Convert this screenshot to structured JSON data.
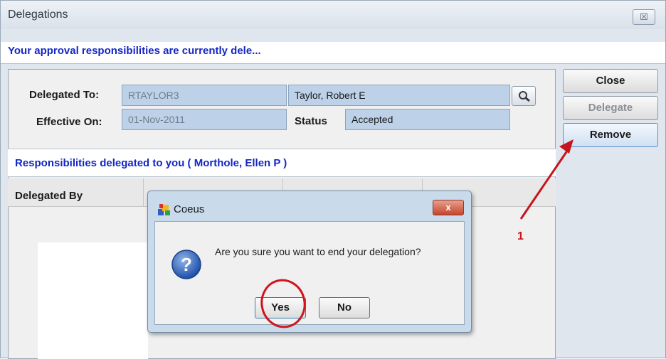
{
  "window": {
    "title": "Delegations",
    "close_glyph": "☒"
  },
  "message": "Your approval responsibilities are currently dele...",
  "form": {
    "delegated_to_label": "Delegated To:",
    "delegated_to_id": "RTAYLOR3",
    "delegated_to_name": "Taylor, Robert E",
    "effective_on_label": "Effective On:",
    "effective_on_value": "01-Nov-2011",
    "status_label": "Status",
    "status_value": "Accepted"
  },
  "side_buttons": {
    "close": "Close",
    "delegate": "Delegate",
    "remove": "Remove"
  },
  "responsibilities_title": "Responsibilities delegated to you ( Morthole, Ellen P )",
  "table": {
    "columns": [
      "Delegated By",
      "",
      "",
      ""
    ]
  },
  "dialog": {
    "title": "Coeus",
    "close_glyph": "x",
    "question": "Are you sure you want to end your delegation?",
    "yes": "Yes",
    "no": "No"
  },
  "annotation": {
    "step": "1",
    "color": "#c4161c"
  }
}
